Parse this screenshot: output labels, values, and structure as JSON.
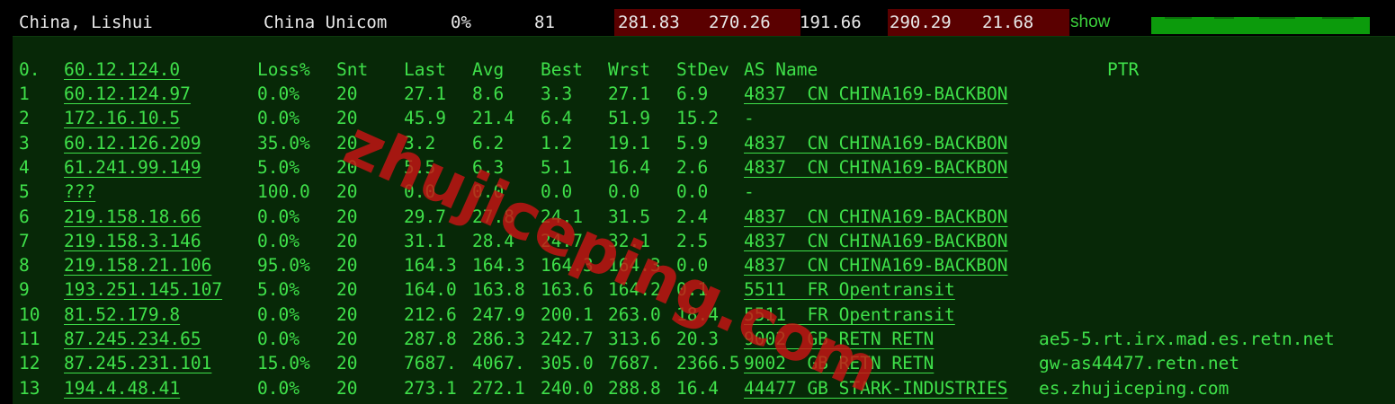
{
  "summary": {
    "location": "China, Lishui",
    "isp": "China Unicom",
    "loss": "0%",
    "sent": "81",
    "last": "281.83",
    "avg": "270.26",
    "best": "191.66",
    "worst": "290.29",
    "stdev": "21.68",
    "show_label": "show",
    "accent_bar_color": "#0c9b0c",
    "highlight_color": "#5a0000"
  },
  "trace": {
    "headers": {
      "hop": "0.",
      "host": "60.12.124.0",
      "loss": "Loss%",
      "snt": "Snt",
      "last": "Last",
      "avg": "Avg",
      "best": "Best",
      "wrst": "Wrst",
      "stdev": "StDev",
      "as_name": "AS Name",
      "ptr": "PTR"
    },
    "rows": [
      {
        "hop": "1",
        "host": "60.12.124.97",
        "loss": "0.0%",
        "snt": "20",
        "last": "27.1",
        "avg": "8.6",
        "best": "3.3",
        "wrst": "27.1",
        "stdev": "6.9",
        "as": "4837  CN CHINA169-BACKBON",
        "ptr": ""
      },
      {
        "hop": "2",
        "host": "172.16.10.5",
        "loss": "0.0%",
        "snt": "20",
        "last": "45.9",
        "avg": "21.4",
        "best": "6.4",
        "wrst": "51.9",
        "stdev": "15.2",
        "as": "-",
        "ptr": ""
      },
      {
        "hop": "3",
        "host": "60.12.126.209",
        "loss": "35.0%",
        "snt": "20",
        "last": "3.2",
        "avg": "6.2",
        "best": "1.2",
        "wrst": "19.1",
        "stdev": "5.9",
        "as": "4837  CN CHINA169-BACKBON",
        "ptr": ""
      },
      {
        "hop": "4",
        "host": "61.241.99.149",
        "loss": "5.0%",
        "snt": "20",
        "last": "5.5",
        "avg": "6.3",
        "best": "5.1",
        "wrst": "16.4",
        "stdev": "2.6",
        "as": "4837  CN CHINA169-BACKBON",
        "ptr": ""
      },
      {
        "hop": "5",
        "host": "???",
        "loss": "100.0",
        "snt": "20",
        "last": "0.0",
        "avg": "0.0",
        "best": "0.0",
        "wrst": "0.0",
        "stdev": "0.0",
        "as": "-",
        "ptr": ""
      },
      {
        "hop": "6",
        "host": "219.158.18.66",
        "loss": "0.0%",
        "snt": "20",
        "last": "29.7",
        "avg": "27.8",
        "best": "24.1",
        "wrst": "31.5",
        "stdev": "2.4",
        "as": "4837  CN CHINA169-BACKBON",
        "ptr": ""
      },
      {
        "hop": "7",
        "host": "219.158.3.146",
        "loss": "0.0%",
        "snt": "20",
        "last": "31.1",
        "avg": "28.4",
        "best": "24.7",
        "wrst": "32.1",
        "stdev": "2.5",
        "as": "4837  CN CHINA169-BACKBON",
        "ptr": ""
      },
      {
        "hop": "8",
        "host": "219.158.21.106",
        "loss": "95.0%",
        "snt": "20",
        "last": "164.3",
        "avg": "164.3",
        "best": "164.3",
        "wrst": "164.3",
        "stdev": "0.0",
        "as": "4837  CN CHINA169-BACKBON",
        "ptr": ""
      },
      {
        "hop": "9",
        "host": "193.251.145.107",
        "loss": "5.0%",
        "snt": "20",
        "last": "164.0",
        "avg": "163.8",
        "best": "163.6",
        "wrst": "164.2",
        "stdev": "0.1",
        "as": "5511  FR Opentransit",
        "ptr": ""
      },
      {
        "hop": "10",
        "host": "81.52.179.8",
        "loss": "0.0%",
        "snt": "20",
        "last": "212.6",
        "avg": "247.9",
        "best": "200.1",
        "wrst": "263.0",
        "stdev": "18.4",
        "as": "5511  FR Opentransit",
        "ptr": ""
      },
      {
        "hop": "11",
        "host": "87.245.234.65",
        "loss": "0.0%",
        "snt": "20",
        "last": "287.8",
        "avg": "286.3",
        "best": "242.7",
        "wrst": "313.6",
        "stdev": "20.3",
        "as": "9002  GB RETN RETN",
        "ptr": "ae5-5.rt.irx.mad.es.retn.net"
      },
      {
        "hop": "12",
        "host": "87.245.231.101",
        "loss": "15.0%",
        "snt": "20",
        "last": "7687.",
        "avg": "4067.",
        "best": "305.0",
        "wrst": "7687.",
        "stdev": "2366.5",
        "as": "9002  GB RETN RETN",
        "ptr": "gw-as44477.retn.net"
      },
      {
        "hop": "13",
        "host": "194.4.48.41",
        "loss": "0.0%",
        "snt": "20",
        "last": "273.1",
        "avg": "272.1",
        "best": "240.0",
        "wrst": "288.8",
        "stdev": "16.4",
        "as": "44477 GB STARK-INDUSTRIES",
        "ptr": "es.zhujiceping.com"
      }
    ]
  },
  "watermark": "zhujiceping.com"
}
